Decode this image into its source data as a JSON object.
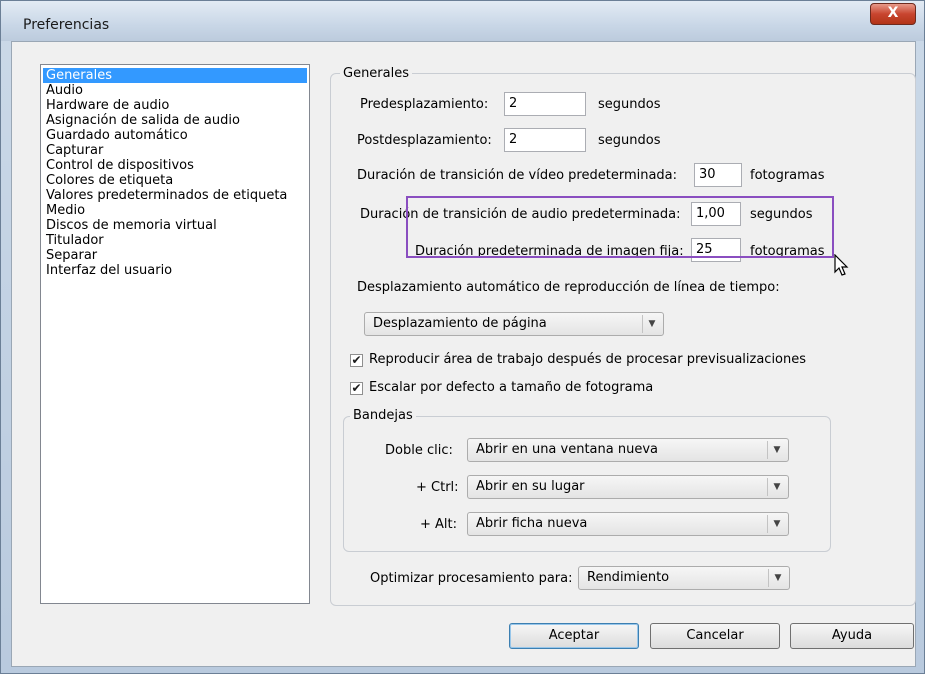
{
  "window": {
    "title": "Preferencias",
    "close_label": "X"
  },
  "categories": [
    "Generales",
    "Audio",
    "Hardware de audio",
    "Asignación de salida de audio",
    "Guardado automático",
    "Capturar",
    "Control de dispositivos",
    "Colores de etiqueta",
    "Valores predeterminados de etiqueta",
    "Medio",
    "Discos de memoria virtual",
    "Titulador",
    "Separar",
    "Interfaz del usuario"
  ],
  "selected_category": "Generales",
  "general": {
    "group_label": "Generales",
    "preroll": {
      "label": "Predesplazamiento:",
      "value": "2",
      "unit": "segundos"
    },
    "postroll": {
      "label": "Postdesplazamiento:",
      "value": "2",
      "unit": "segundos"
    },
    "video_transition": {
      "label": "Duración de transición de vídeo predeterminada:",
      "value": "30",
      "unit": "fotogramas"
    },
    "audio_transition": {
      "label": "Duración de transición de audio predeterminada:",
      "value": "1,00",
      "unit": "segundos"
    },
    "still_image": {
      "label": "Duración predeterminada de imagen fija:",
      "value": "25",
      "unit": "fotogramas"
    },
    "autoscroll_label": "Desplazamiento automático de reproducción de línea de tiempo:",
    "autoscroll_value": "Desplazamiento de página",
    "play_work_area": {
      "label": "Reproducir área de trabajo después de procesar previsualizaciones",
      "checked": true
    },
    "scale_default": {
      "label": "Escalar por defecto a tamaño de fotograma",
      "checked": true
    },
    "bins": {
      "group_label": "Bandejas",
      "double_click": {
        "label": "Doble clic:",
        "value": "Abrir en una ventana nueva"
      },
      "ctrl": {
        "label": "+ Ctrl:",
        "value": "Abrir en su lugar"
      },
      "alt": {
        "label": "+ Alt:",
        "value": "Abrir ficha nueva"
      }
    },
    "optimize": {
      "label": "Optimizar procesamiento para:",
      "value": "Rendimiento"
    }
  },
  "buttons": {
    "ok": "Aceptar",
    "cancel": "Cancelar",
    "help": "Ayuda"
  },
  "icons": {
    "dropdown": "chevron-down-icon",
    "check": "checkmark-icon",
    "cursor": "mouse-pointer-icon"
  },
  "colors": {
    "selection": "#3399ff",
    "annotation": "#8a4ec0"
  }
}
